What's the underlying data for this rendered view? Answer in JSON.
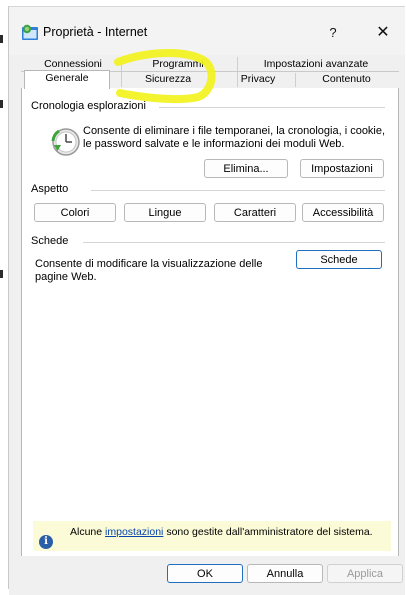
{
  "window": {
    "title": "Proprietà - Internet",
    "help_glyph": "?",
    "close_glyph": "✕"
  },
  "tabs": {
    "row1": [
      "Connessioni",
      "Programmi",
      "Impostazioni avanzate"
    ],
    "row2": [
      "Generale",
      "Sicurezza",
      "Privacy",
      "Contenuto"
    ],
    "active": "Generale"
  },
  "history": {
    "heading": "Cronologia esplorazioni",
    "description_line1": "Consente di eliminare i file temporanei, la cronologia, i cookie,",
    "description_line2": "le password salvate e le informazioni dei moduli Web.",
    "delete_label": "Elimina...",
    "settings_label": "Impostazioni"
  },
  "appearance": {
    "heading": "Aspetto",
    "buttons": [
      "Colori",
      "Lingue",
      "Caratteri",
      "Accessibilità"
    ]
  },
  "tabs_group": {
    "heading": "Schede",
    "description_line1": "Consente di modificare la visualizzazione delle",
    "description_line2": "pagine Web.",
    "button_label": "Schede"
  },
  "notice": {
    "prefix": "Alcune ",
    "link": "impostazioni",
    "suffix": " sono gestite dall'amministratore del sistema."
  },
  "footer": {
    "ok": "OK",
    "cancel": "Annulla",
    "apply": "Applica"
  },
  "colors": {
    "highlight": "#f2f21a",
    "info_bar": "#fbfbd8",
    "default_button_border": "#1f6fbf"
  }
}
